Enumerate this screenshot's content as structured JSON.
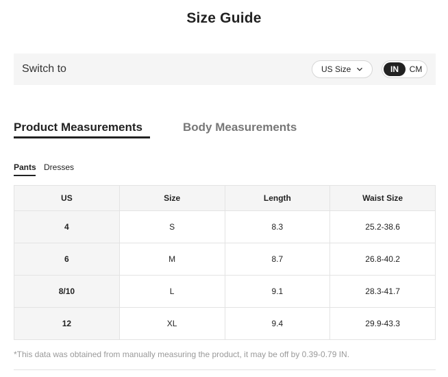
{
  "title": "Size Guide",
  "switch_bar": {
    "label": "Switch to",
    "size_select": {
      "value": "US Size",
      "icon": "chevron-down-icon"
    },
    "unit_toggle": {
      "options": [
        "IN",
        "CM"
      ],
      "selected": "IN"
    }
  },
  "main_tabs": [
    {
      "label": "Product Measurements",
      "active": true
    },
    {
      "label": "Body Measurements",
      "active": false
    }
  ],
  "sub_tabs": [
    {
      "label": "Pants",
      "active": true
    },
    {
      "label": "Dresses",
      "active": false
    }
  ],
  "table": {
    "headers": [
      "US",
      "Size",
      "Length",
      "Waist Size"
    ],
    "rows": [
      [
        "4",
        "S",
        "8.3",
        "25.2-38.6"
      ],
      [
        "6",
        "M",
        "8.7",
        "26.8-40.2"
      ],
      [
        "8/10",
        "L",
        "9.1",
        "28.3-41.7"
      ],
      [
        "12",
        "XL",
        "9.4",
        "29.9-43.3"
      ]
    ]
  },
  "footnote": "*This data was obtained from manually measuring the product, it may be off by 0.39-0.79 IN.",
  "colors": {
    "active_dark": "#222222",
    "panel_background": "#f5f5f5",
    "muted_text": "#777777"
  }
}
